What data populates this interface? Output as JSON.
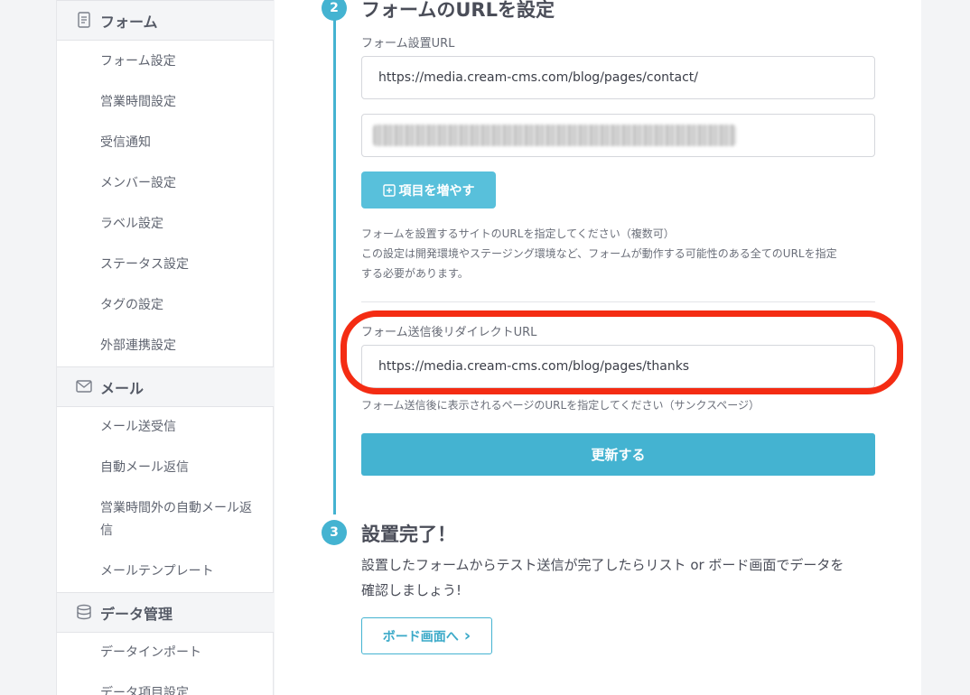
{
  "sidebar": {
    "sections": [
      {
        "label": "フォーム",
        "icon": "document-icon"
      },
      {
        "label": "メール",
        "icon": "mail-icon"
      },
      {
        "label": "データ管理",
        "icon": "database-icon"
      }
    ],
    "form_items": [
      "フォーム設定",
      "営業時間設定",
      "受信通知",
      "メンバー設定",
      "ラベル設定",
      "ステータス設定",
      "タグの設定",
      "外部連携設定"
    ],
    "mail_items": [
      "メール送受信",
      "自動メール返信",
      "営業時間外の自動メール返信",
      "メールテンプレート"
    ],
    "data_items": [
      "データインポート",
      "データ項目設定"
    ]
  },
  "step2": {
    "number": "2",
    "title": "フォームのURLを設定",
    "url_label": "フォーム設置URL",
    "url_value": "https://media.cream-cms.com/blog/pages/contact/",
    "add_button": "項目を増やす",
    "help_line1": "フォームを設置するサイトのURLを指定してください（複数可）",
    "help_line2": "この設定は開発環境やステージング環境など、フォームが動作する可能性のある全てのURLを指定",
    "help_line3": "する必要があります。",
    "redirect_label": "フォーム送信後リダイレクトURL",
    "redirect_value": "https://media.cream-cms.com/blog/pages/thanks",
    "redirect_help": "フォーム送信後に表示されるページのURLを指定してください（サンクスページ）",
    "update_button": "更新する"
  },
  "step3": {
    "number": "3",
    "title": "設置完了！",
    "desc_line1": "設置したフォームからテスト送信が完了したらリスト or ボード画面でデータを",
    "desc_line2": "確認しましょう!",
    "board_button": "ボード画面へ",
    "board_arrow": "›"
  },
  "colors": {
    "accent": "#44b3d1",
    "accent_light": "#58c0db",
    "highlight": "#f42c13"
  }
}
